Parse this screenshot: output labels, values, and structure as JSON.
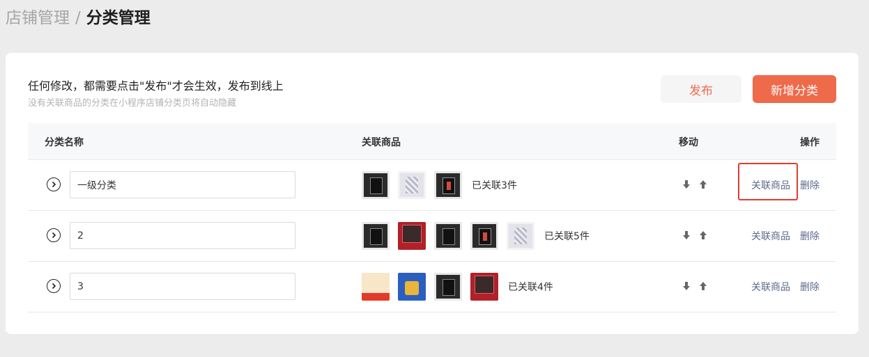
{
  "breadcrumb": {
    "parent": "店铺管理",
    "separator": "/",
    "current": "分类管理"
  },
  "notice": {
    "title": "任何修改，都需要点击\"发布\"才会生效，发布到线上",
    "subtitle": "没有关联商品的分类在小程序店铺分类页将自动隐藏"
  },
  "buttons": {
    "publish": "发布",
    "add_category": "新增分类"
  },
  "colors": {
    "accent": "#ee6a4b",
    "link": "#5c6b8a",
    "highlight": "#e03b2f"
  },
  "table": {
    "headers": {
      "name": "分类名称",
      "goods": "关联商品",
      "move": "移动",
      "operation": "操作"
    },
    "rows": [
      {
        "name": "一级分类",
        "thumbs": [
          "dark",
          "light",
          "redcard"
        ],
        "count_text": "已关联3件",
        "link_label": "关联商品",
        "delete_label": "删除",
        "highlighted": true
      },
      {
        "name": "2",
        "thumbs": [
          "dark",
          "redbox",
          "dark",
          "redcard",
          "light"
        ],
        "count_text": "已关联5件",
        "link_label": "关联商品",
        "delete_label": "删除",
        "highlighted": false
      },
      {
        "name": "3",
        "thumbs": [
          "promo",
          "blue",
          "dark",
          "redbox"
        ],
        "count_text": "已关联4件",
        "link_label": "关联商品",
        "delete_label": "删除",
        "highlighted": false
      }
    ]
  },
  "icons": {
    "expand": "chevron-right-circle-icon",
    "down": "arrow-down-icon",
    "up": "arrow-up-icon"
  }
}
